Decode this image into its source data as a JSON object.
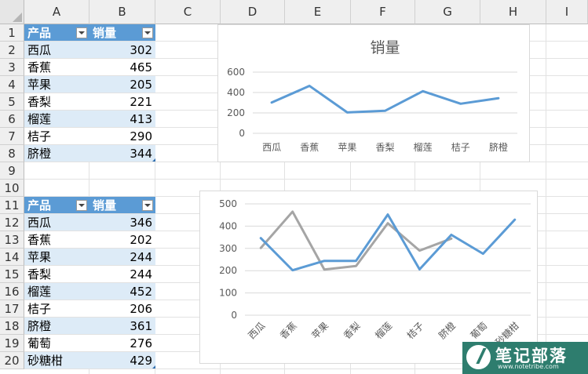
{
  "columns": [
    "A",
    "B",
    "C",
    "D",
    "E",
    "F",
    "G",
    "H",
    "I"
  ],
  "rows": [
    "1",
    "2",
    "3",
    "4",
    "5",
    "6",
    "7",
    "8",
    "9",
    "10",
    "11",
    "12",
    "13",
    "14",
    "15",
    "16",
    "17",
    "18",
    "19",
    "20"
  ],
  "table1": {
    "headers": [
      "产品",
      "销量"
    ],
    "rows": [
      {
        "product": "西瓜",
        "sales": "302"
      },
      {
        "product": "香蕉",
        "sales": "465"
      },
      {
        "product": "苹果",
        "sales": "205"
      },
      {
        "product": "香梨",
        "sales": "221"
      },
      {
        "product": "榴莲",
        "sales": "413"
      },
      {
        "product": "桔子",
        "sales": "290"
      },
      {
        "product": "脐橙",
        "sales": "344"
      }
    ]
  },
  "table2": {
    "headers": [
      "产品",
      "销量"
    ],
    "rows": [
      {
        "product": "西瓜",
        "sales": "346"
      },
      {
        "product": "香蕉",
        "sales": "202"
      },
      {
        "product": "苹果",
        "sales": "244"
      },
      {
        "product": "香梨",
        "sales": "244"
      },
      {
        "product": "榴莲",
        "sales": "452"
      },
      {
        "product": "桔子",
        "sales": "206"
      },
      {
        "product": "脐橙",
        "sales": "361"
      },
      {
        "product": "葡萄",
        "sales": "276"
      },
      {
        "product": "砂糖柑",
        "sales": "429"
      }
    ]
  },
  "colors": {
    "header_fill": "#5b9bd5",
    "band_fill": "#ddebf7",
    "series_blue": "#5b9bd5",
    "series_gray": "#a5a5a5",
    "logo_green": "#2e7d6e"
  },
  "chart_data": [
    {
      "type": "line",
      "title": "销量",
      "categories": [
        "西瓜",
        "香蕉",
        "苹果",
        "香梨",
        "榴莲",
        "桔子",
        "脐橙"
      ],
      "series": [
        {
          "values": [
            302,
            465,
            205,
            221,
            413,
            290,
            344
          ],
          "color": "#5b9bd5"
        }
      ],
      "y_ticks": [
        "0",
        "200",
        "400",
        "600"
      ],
      "ylim": [
        0,
        600
      ],
      "grid": true,
      "xlabel": "",
      "ylabel": ""
    },
    {
      "type": "line",
      "title": "",
      "categories": [
        "西瓜",
        "香蕉",
        "苹果",
        "香梨",
        "榴莲",
        "桔子",
        "脐橙",
        "葡萄",
        "砂糖柑"
      ],
      "series": [
        {
          "values": [
            346,
            202,
            244,
            244,
            452,
            206,
            361,
            276,
            429
          ],
          "color": "#5b9bd5"
        },
        {
          "values": [
            302,
            465,
            205,
            221,
            413,
            290,
            344
          ],
          "color": "#a5a5a5"
        }
      ],
      "y_ticks": [
        "0",
        "100",
        "200",
        "300",
        "400",
        "500"
      ],
      "ylim": [
        0,
        500
      ],
      "grid": true,
      "x_label_rotation": -45,
      "xlabel": "",
      "ylabel": ""
    }
  ],
  "logo": {
    "name": "笔记部落",
    "site": "www.notetribe.com",
    "icon": "pencil-icon"
  }
}
